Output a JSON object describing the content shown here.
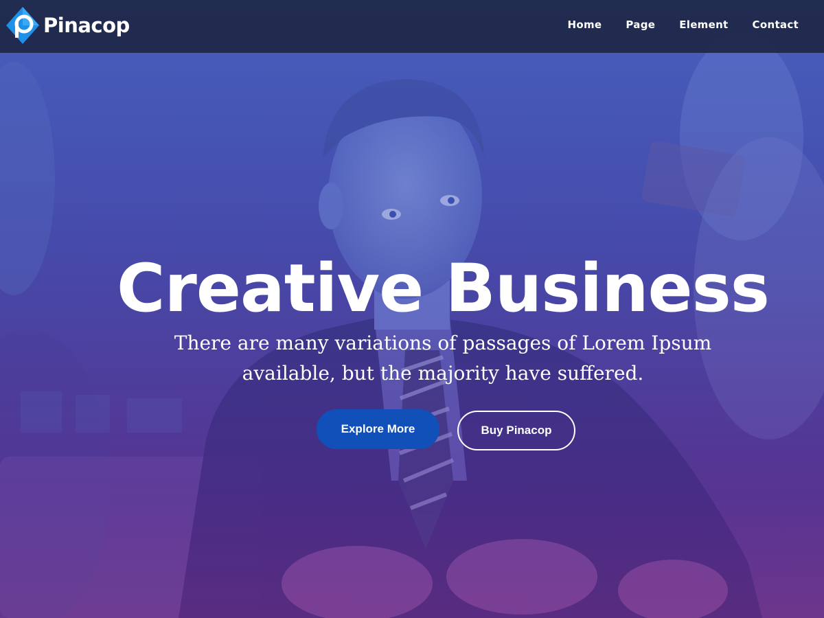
{
  "header": {
    "brand_name": "Pinacop",
    "logo_letter": "p",
    "nav": [
      {
        "label": "Home"
      },
      {
        "label": "Page"
      },
      {
        "label": "Element"
      },
      {
        "label": "Contact"
      }
    ]
  },
  "hero": {
    "title": "Creative Business",
    "subtitle_line1": "There are many variations of passages of Lorem Ipsum",
    "subtitle_line2": "available, but the majority have suffered.",
    "primary_button": "Explore More",
    "secondary_button": "Buy Pinacop"
  },
  "colors": {
    "topbar": "#1e2848",
    "primary_button": "#1150b8",
    "logo_blue": "#1e90e8",
    "overlay_top": "#4a5fb8",
    "overlay_bottom": "#6a3a8c"
  },
  "icons": {
    "logo": "diamond-p-logo-icon"
  }
}
